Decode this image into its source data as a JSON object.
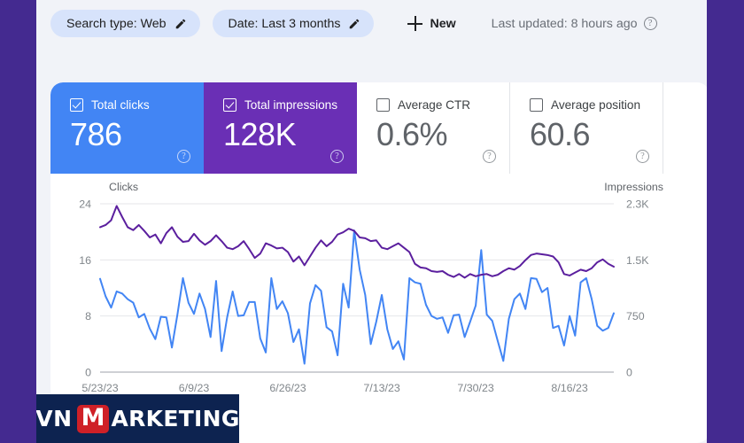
{
  "theme": {
    "frame_color": "#442a90",
    "surface_color": "#f1f3f8",
    "panel_color": "#ffffff",
    "clicks_color": "#4285f4",
    "impressions_color": "#6a2fb5",
    "chip_color": "#d7e3fb",
    "watermark_bg": "#0d2350",
    "watermark_accent": "#cf2027"
  },
  "filterbar": {
    "chips": [
      {
        "label": "Search type: Web",
        "icon": "pencil-icon"
      },
      {
        "label": "Date: Last 3 months",
        "icon": "pencil-icon"
      }
    ],
    "new_label": "New",
    "new_icon": "plus-icon",
    "last_updated": "Last updated: 8 hours ago",
    "help_icon": "help-circle-icon",
    "help_glyph": "?"
  },
  "metrics": [
    {
      "label": "Total clicks",
      "value": "786",
      "checked": true,
      "state": "active-blue",
      "checkbox_icon": "checkbox-checked-icon",
      "help_icon": "help-circle-icon"
    },
    {
      "label": "Total impressions",
      "value": "128K",
      "checked": true,
      "state": "active-purple",
      "checkbox_icon": "checkbox-checked-icon",
      "help_icon": "help-circle-icon"
    },
    {
      "label": "Average CTR",
      "value": "0.6%",
      "checked": false,
      "state": "plain",
      "checkbox_icon": "checkbox-empty-icon",
      "help_icon": "help-circle-icon"
    },
    {
      "label": "Average position",
      "value": "60.6",
      "checked": false,
      "state": "plain",
      "checkbox_icon": "checkbox-empty-icon",
      "help_icon": "help-circle-icon"
    }
  ],
  "chart_data": {
    "type": "line",
    "title": "",
    "xlabel": "",
    "ylabel": "Clicks",
    "y2label": "Impressions",
    "grid": true,
    "legend": "none",
    "y_left_label": "Clicks",
    "y_right_label": "Impressions",
    "y_left_ticks": [
      "0",
      "8",
      "16",
      "24"
    ],
    "y_left_values": [
      0,
      8,
      16,
      24
    ],
    "ylim": [
      0,
      24
    ],
    "y_right_ticks": [
      "0",
      "750",
      "1.5K",
      "2.3K"
    ],
    "y_right_values": [
      0,
      750,
      1500,
      2300
    ],
    "y2lim": [
      0,
      2300
    ],
    "x_ticks": [
      "5/23/23",
      "6/9/23",
      "6/26/23",
      "7/13/23",
      "7/30/23",
      "8/16/23"
    ],
    "x_tick_positions": [
      0,
      17,
      34,
      51,
      68,
      85
    ],
    "n_points": 94,
    "series": [
      {
        "name": "Total clicks",
        "color": "#4285f4",
        "axis": "left",
        "unit": "clicks",
        "values": [
          13.3,
          10.8,
          9.2,
          11.5,
          11.2,
          10.4,
          9.9,
          7.8,
          8.3,
          6.2,
          4.7,
          7.9,
          7.8,
          3.5,
          8.2,
          13.4,
          9.9,
          8.3,
          11.2,
          9.0,
          5.0,
          13.0,
          3.0,
          7.8,
          11.5,
          8.0,
          8.1,
          10.0,
          10.0,
          4.8,
          2.8,
          13.4,
          9.0,
          10.1,
          8.4,
          4.3,
          6.1,
          1.2,
          9.8,
          12.4,
          11.6,
          6.4,
          5.8,
          2.4,
          12.6,
          9.2,
          20.2,
          14.6,
          11.0,
          4.0,
          7.2,
          11.0,
          6.1,
          3.3,
          4.4,
          1.8,
          13.4,
          12.8,
          12.6,
          9.6,
          8.0,
          7.6,
          7.8,
          5.6,
          8.1,
          8.2,
          5.0,
          7.2,
          9.5,
          17.4,
          8.2,
          7.3,
          4.4,
          1.6,
          7.6,
          10.4,
          11.2,
          9.0,
          13.4,
          13.3,
          11.4,
          12.0,
          6.3,
          6.6,
          3.8,
          8.0,
          5.2,
          12.8,
          13.4,
          10.4,
          6.6,
          5.9,
          6.3,
          8.4
        ]
      },
      {
        "name": "Total impressions",
        "color": "#5b1f9e",
        "axis": "right",
        "unit": "impressions",
        "values": [
          1980,
          2010,
          2075,
          2270,
          2120,
          1980,
          1940,
          2010,
          1930,
          1840,
          1880,
          1760,
          1900,
          1980,
          1850,
          1780,
          1790,
          1890,
          1800,
          1740,
          1790,
          1870,
          1790,
          1700,
          1680,
          1720,
          1790,
          1680,
          1560,
          1620,
          1760,
          1730,
          1690,
          1700,
          1640,
          1510,
          1580,
          1460,
          1580,
          1700,
          1800,
          1720,
          1780,
          1880,
          1910,
          1960,
          1930,
          1840,
          1830,
          1790,
          1800,
          1700,
          1680,
          1720,
          1760,
          1700,
          1640,
          1480,
          1430,
          1420,
          1380,
          1370,
          1380,
          1330,
          1300,
          1340,
          1290,
          1340,
          1310,
          1330,
          1340,
          1310,
          1330,
          1380,
          1420,
          1400,
          1450,
          1530,
          1600,
          1620,
          1610,
          1600,
          1580,
          1500,
          1340,
          1320,
          1360,
          1400,
          1380,
          1420,
          1500,
          1540,
          1480,
          1440
        ]
      }
    ]
  },
  "watermark": {
    "part1": "VN",
    "accent": "M",
    "part2": "ARKETING"
  }
}
